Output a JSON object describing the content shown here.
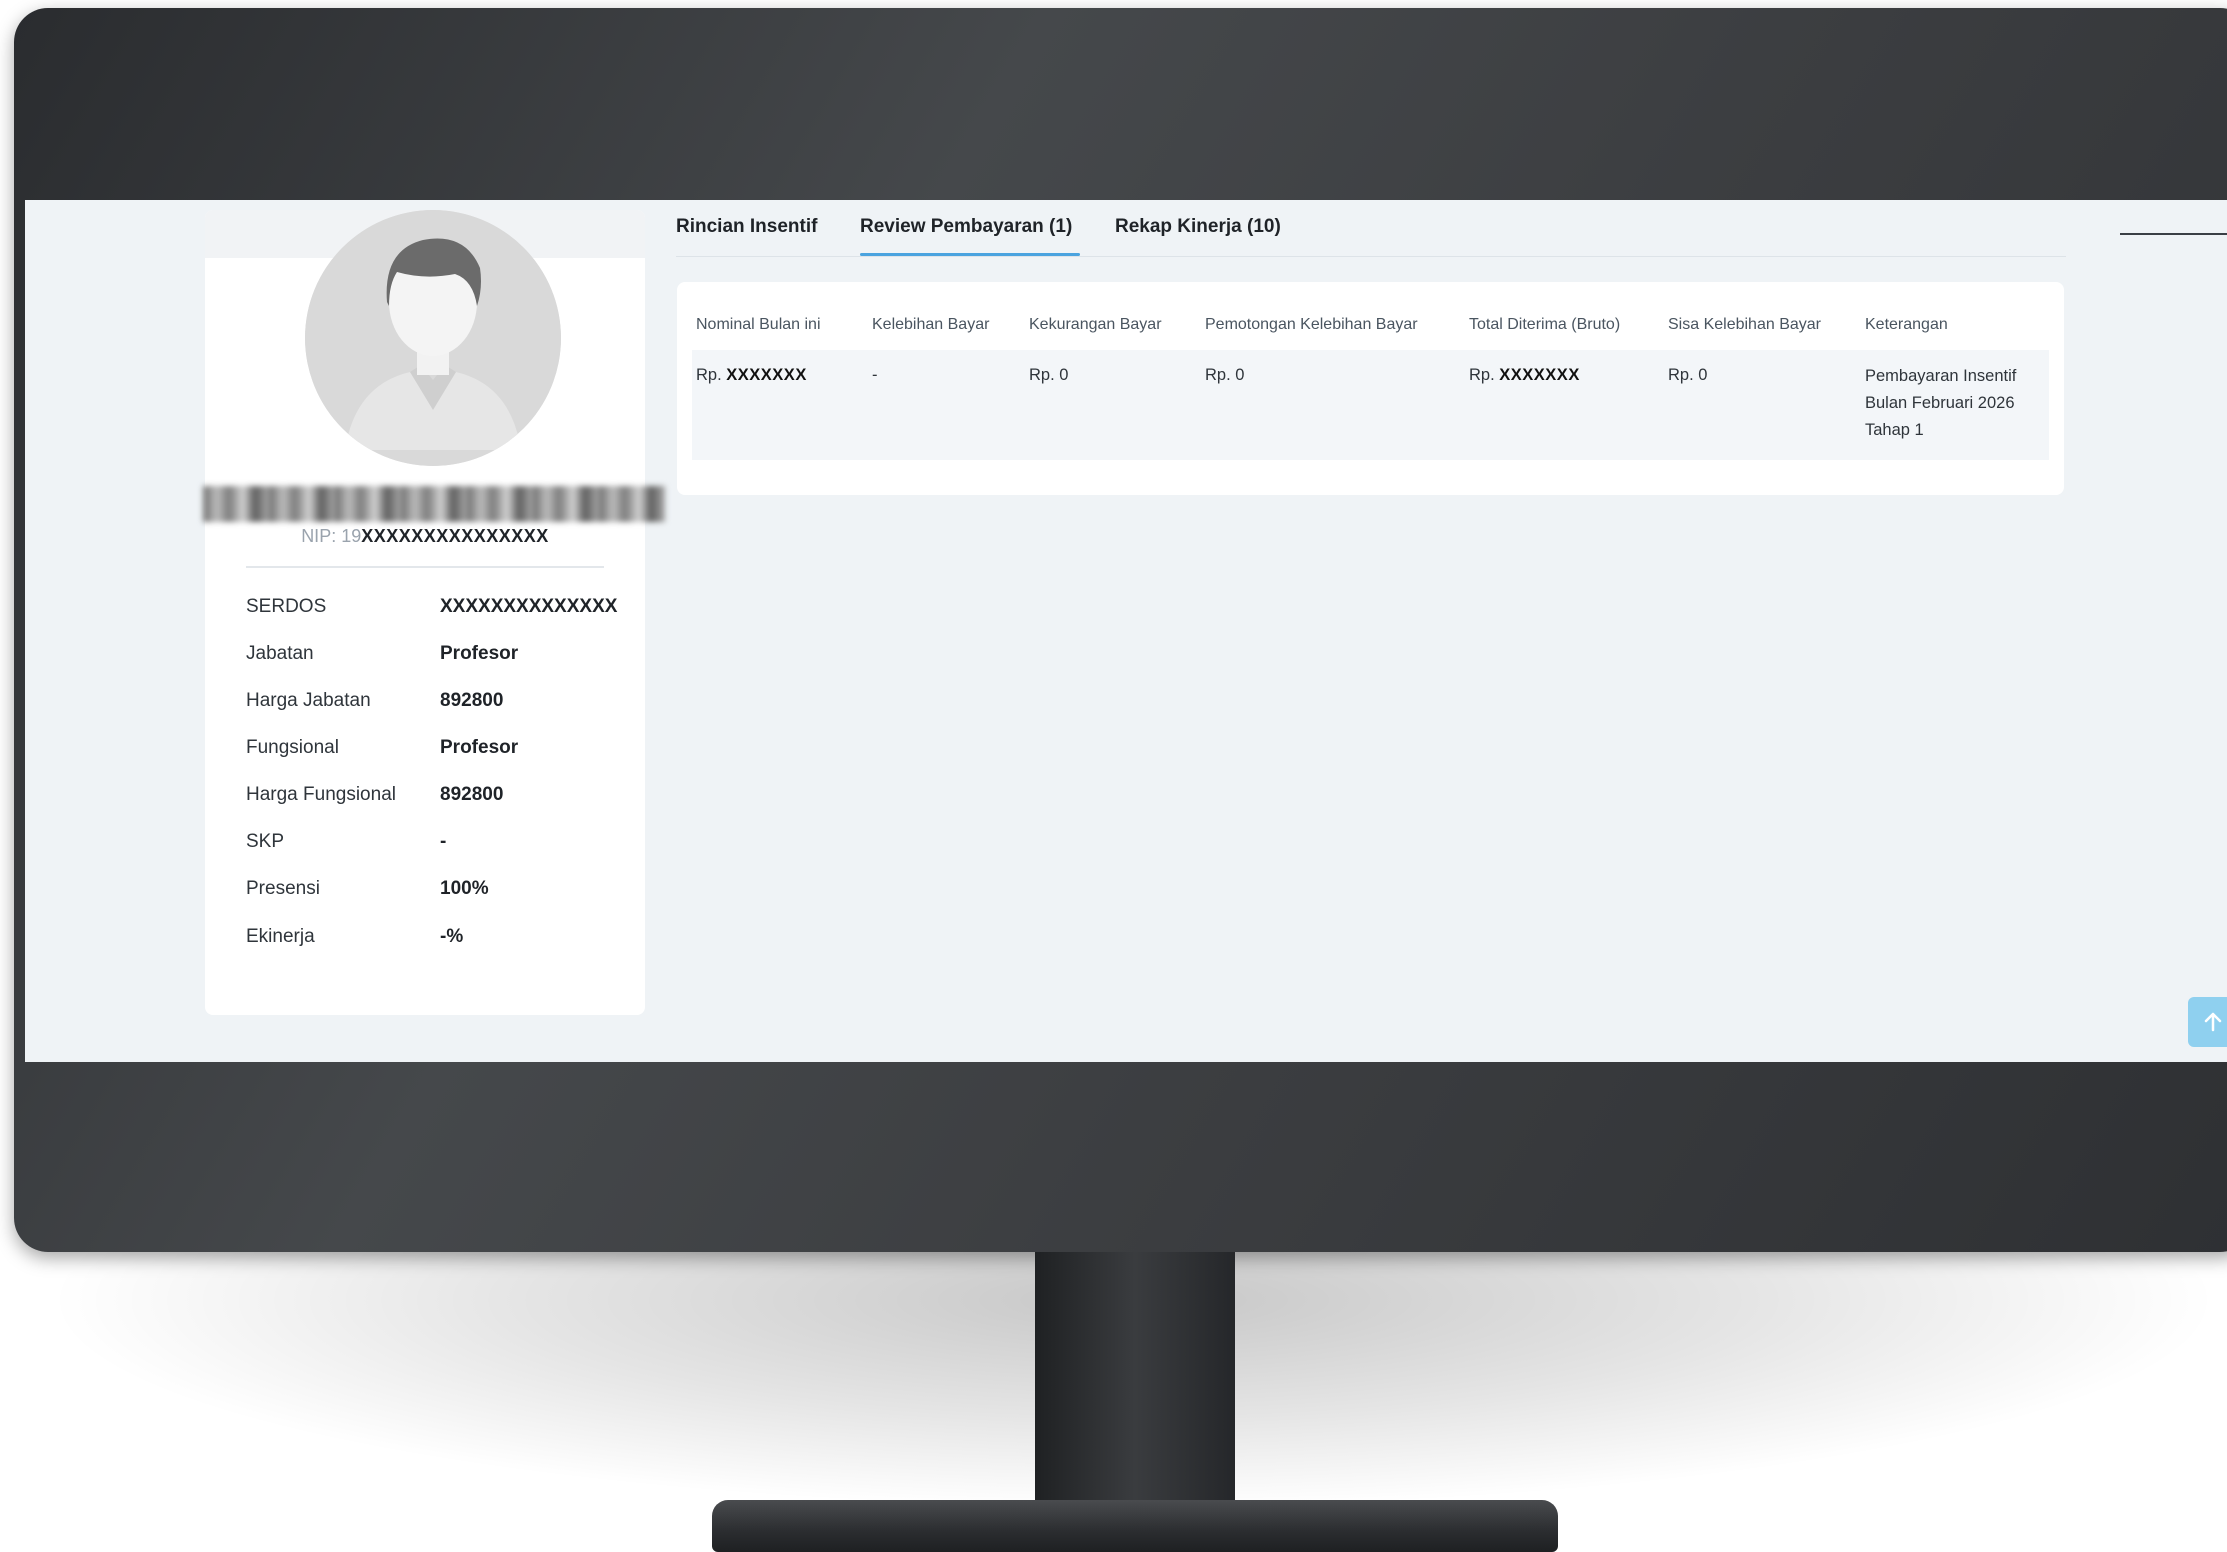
{
  "profile": {
    "nip_prefix": "NIP: 19",
    "nip_redacted": "XXXXXXXXXXXXXXX",
    "fields": [
      {
        "label": "SERDOS",
        "value": "XXXXXXXXXXXXXX"
      },
      {
        "label": "Jabatan",
        "value": "Profesor"
      },
      {
        "label": "Harga Jabatan",
        "value": "892800"
      },
      {
        "label": "Fungsional",
        "value": "Profesor"
      },
      {
        "label": "Harga Fungsional",
        "value": "892800"
      },
      {
        "label": "SKP",
        "value": "-"
      },
      {
        "label": "Presensi",
        "value": "100%"
      },
      {
        "label": "Ekinerja",
        "value": "-%"
      }
    ]
  },
  "tabs": [
    {
      "label": "Rincian Insentif",
      "active": false
    },
    {
      "label": "Review Pembayaran (1)",
      "active": true
    },
    {
      "label": "Rekap Kinerja (10)",
      "active": false
    }
  ],
  "table": {
    "headers": [
      "Nominal Bulan ini",
      "Kelebihan Bayar",
      "Kekurangan Bayar",
      "Pemotongan Kelebihan Bayar",
      "Total Diterima (Bruto)",
      "Sisa Kelebihan Bayar",
      "Keterangan"
    ],
    "row": {
      "nominal_prefix": "Rp.",
      "nominal_redacted": "XXXXXXX",
      "kelebihan": "-",
      "kekurangan": "Rp. 0",
      "pemotongan": "Rp. 0",
      "total_prefix": "Rp.",
      "total_redacted": "XXXXXXX",
      "sisa": "Rp. 0",
      "keterangan": "Pembayaran Insentif Bulan Februari 2026 Tahap 1"
    }
  },
  "icons": {
    "scroll_top": "arrow-up-icon",
    "avatar": "user-placeholder-icon"
  },
  "colors": {
    "accent": "#4aa3df",
    "scroll_button": "#8fd0ef",
    "screen_background": "#eff3f6"
  }
}
